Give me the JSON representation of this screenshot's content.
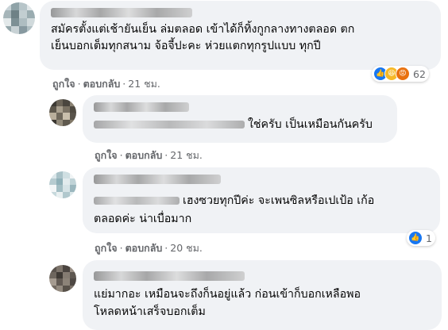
{
  "comments": [
    {
      "text_lines": [
        "สมัครตั้งแต่เช้ายันเย็น ล่มตลอด เข้าได้ก็ทิ้งกูกลางทางตลอด ตก",
        "เย็นบอกเต็มทุกสนาม จ้อจี้ปะคะ ห่วยแตกทุกรูปแบบ ทุกปี"
      ],
      "like_label": "ถูกใจ",
      "reply_label": "ตอบกลับ",
      "time": "21 ชม.",
      "reaction_icons": [
        "like-reaction",
        "haha-reaction",
        "angry-reaction"
      ],
      "reaction_count": "62"
    },
    {
      "text_lines": [
        "ใช่ครับ เป็นเหมือนกันครับ"
      ],
      "like_label": "ถูกใจ",
      "reply_label": "ตอบกลับ",
      "time": "21 ชม."
    },
    {
      "text_lines": [
        "เฮงซวยทุกปีค่ะ จะเพนซิลหรือเปเป้อ เก้อ",
        "ตลอดค่ะ น่าเบื่อมาก"
      ],
      "like_label": "ถูกใจ",
      "reply_label": "ตอบกลับ",
      "time": "20 ชม.",
      "reaction_icons": [
        "like-reaction"
      ],
      "reaction_count": "1"
    },
    {
      "text_lines": [
        "แย่มากอะ เหมือนจะถึงก็นอยู่แล้ว ก่อนเข้าก็บอกเหลือพอ",
        "โหลดหน้าเสร็จบอกเต็ม"
      ]
    }
  ],
  "colors": {
    "bubble": "#f0f2f5",
    "secondary_text": "#65676b",
    "like_blue": "#1877f2",
    "haha_yellow": "#f7b928",
    "angry_orange": "#e9710f"
  }
}
